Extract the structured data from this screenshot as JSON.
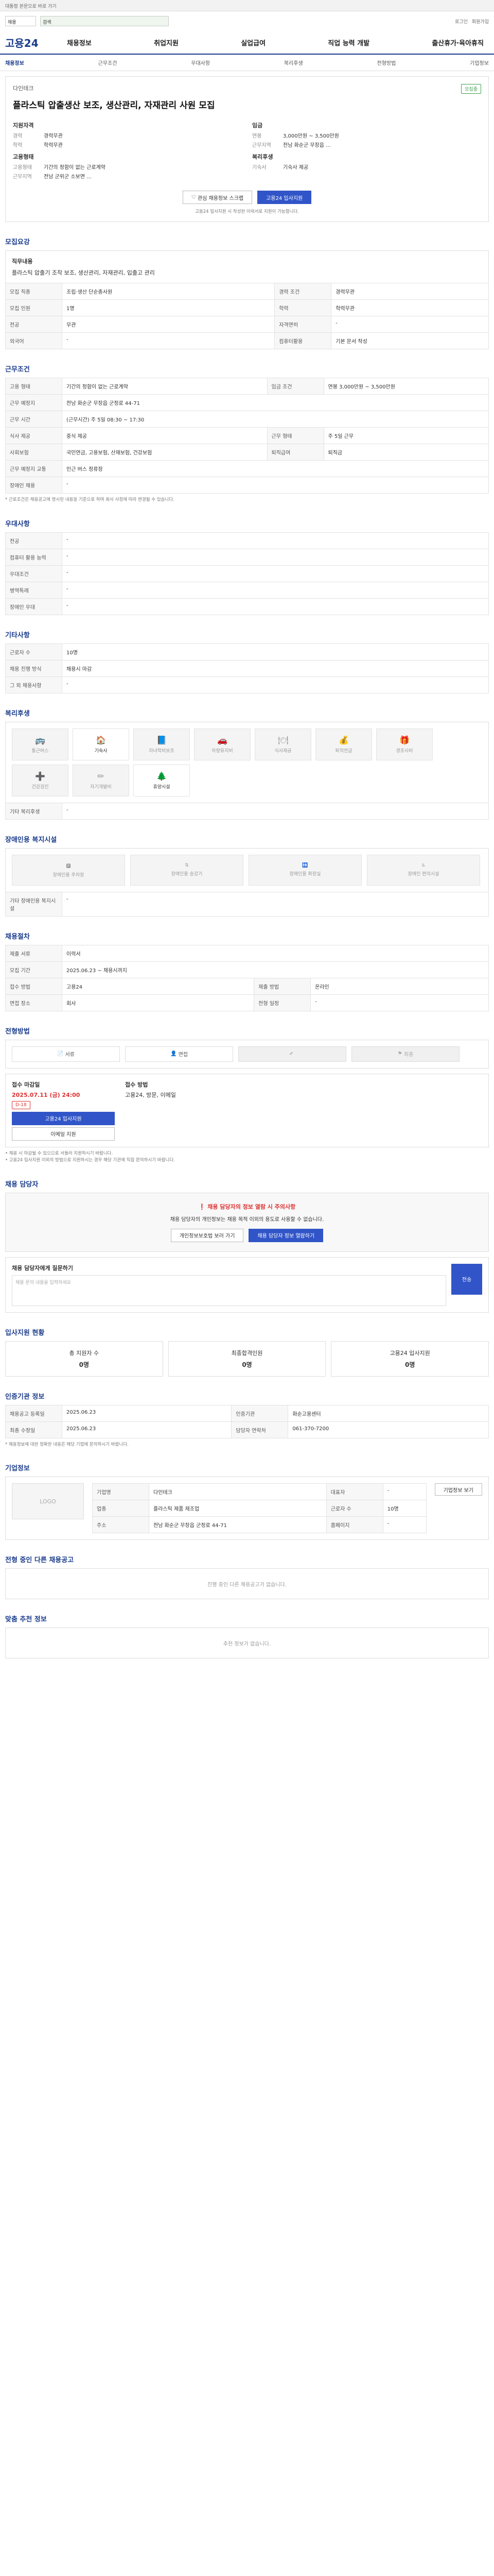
{
  "topbar": {
    "text": "대통령 본문으로 바로 가기"
  },
  "search": {
    "category": "채용",
    "placeholder": "검색"
  },
  "utility": {
    "login": "로그인",
    "join": "회원가입"
  },
  "brand": {
    "logo": "고용24"
  },
  "gnb": [
    "채용정보",
    "취업지원",
    "실업급여",
    "직업 능력 개발",
    "출산휴가·육아휴직"
  ],
  "lnb": [
    "채용정보",
    "근무조건",
    "우대사항",
    "복리후생",
    "전형방법",
    "기업정보"
  ],
  "job": {
    "company": "다인테크",
    "badge": "모집중",
    "title": "플라스틱 압출생산 보조, 생산관리, 자재관리 사원 모집",
    "left": {
      "head": "지원자격",
      "rows": [
        [
          "경력",
          "경력무관"
        ],
        [
          "학력",
          "학력무관"
        ]
      ],
      "head2": "고용형태",
      "rows2": [
        [
          "고용형태",
          "기간의 정함이 없는 근로계약"
        ],
        [
          "근무지역",
          "전남 군위군 소보면 ..."
        ]
      ]
    },
    "right": {
      "head": "임금",
      "rows": [
        [
          "연봉",
          "3,000만원 ~ 3,500만원"
        ],
        [
          "근무지역",
          "전남 화순군 무장읍 ..."
        ]
      ],
      "head2": "복리후생",
      "rows2": [
        [
          "기숙사",
          "기숙사 제공"
        ]
      ]
    },
    "btn_scrap": "관심 채용정보 스크랩",
    "btn_apply": "고용24 입사지원",
    "note": "고용24 입사지원 시 작성한 이력서로 지원이 가능합니다."
  },
  "sections": {
    "s1": "모집요강",
    "s2": "근무조건",
    "s3": "우대사항",
    "s4": "기타사항",
    "s5": "복리후생",
    "s6": "장애인용 복지시설",
    "s7": "채용절차",
    "s8": "전형방법",
    "s9": "채용 담당자",
    "s10": "입사지원 현황",
    "s11": "인증기관 정보",
    "s12": "기업정보",
    "s13": "전형 중인 다른 채용공고",
    "s14": "맞춤 추천 정보"
  },
  "recruit": {
    "duties_label": "직무내용",
    "duties": "플라스틱 압출기 조작 보조, 생산관리, 자재관리, 입출고 관리",
    "rows": [
      [
        "모집 직종",
        "조립·생산 단순종사원",
        "경력 조건",
        "경력무관"
      ],
      [
        "모집 인원",
        "1명",
        "학력",
        "학력무관"
      ],
      [
        "전공",
        "무관",
        "자격면허",
        "-"
      ],
      [
        "외국어",
        "-",
        "컴퓨터활용",
        "기본 문서 작성"
      ]
    ]
  },
  "cond": {
    "rows": [
      [
        "고용 형태",
        "기간의 정함이 없는 근로계약",
        "임금 조건",
        "연봉 3,000만원 ~ 3,500만원"
      ],
      [
        "근무 예정지",
        "전남 화순군 무장읍 군정로 44-71",
        "",
        ""
      ],
      [
        "근무 시간",
        "(근무시간) 주 5일 08:30 ~ 17:30",
        "",
        ""
      ],
      [
        "식사 제공",
        "중식 제공",
        "근무 형태",
        "주 5일 근무"
      ],
      [
        "사회보험",
        "국민연금, 고용보험, 산재보험, 건강보험",
        "퇴직급여",
        "퇴직금"
      ],
      [
        "근무 예정지 교통",
        "인근 버스 정류장",
        "",
        ""
      ],
      [
        "장애인 채용",
        "-",
        "",
        ""
      ]
    ],
    "foot": "* 근로조건은 채용공고에 명시된 내용을 기준으로 하며 회사 사정에 따라 변경될 수 있습니다."
  },
  "pref": {
    "rows": [
      [
        "전공",
        "-"
      ],
      [
        "컴퓨터 활용 능력",
        "-"
      ],
      [
        "우대조건",
        "-"
      ],
      [
        "병역특례",
        "-"
      ],
      [
        "장애인 우대",
        "-"
      ]
    ]
  },
  "etc": {
    "rows": [
      [
        "근로자 수",
        "10명"
      ],
      [
        "채용 진행 방식",
        "채용시 마감"
      ],
      [
        "그 외 채용사항",
        "-"
      ]
    ]
  },
  "welfare": {
    "items": [
      "통근버스",
      "기숙사",
      "자녀학비보조",
      "차량유지비",
      "식사제공",
      "퇴직연금",
      "경조사비",
      "건강검진",
      "자기개발비",
      "휴양시설"
    ],
    "on": [
      1,
      9
    ],
    "other_label": "기타 복리후생",
    "other": "-"
  },
  "facility": {
    "items": [
      "장애인용 주차장",
      "장애인용 승강기",
      "장애인용 화장실",
      "장애인 편의시설"
    ],
    "other_label": "기타 장애인용 복지시설",
    "other": "-"
  },
  "process": {
    "rows": [
      [
        "제출 서류",
        "이력서",
        "",
        ""
      ],
      [
        "모집 기간",
        "2025.06.23 ~ 채용시까지",
        "",
        ""
      ],
      [
        "접수 방법",
        "고용24",
        "제출 방법",
        "온라인"
      ],
      [
        "면접 장소",
        "회사",
        "전형 일정",
        "-"
      ]
    ]
  },
  "method": {
    "steps": [
      "서류",
      "면접",
      "",
      "최종"
    ],
    "deadline_label": "접수 마감일",
    "deadline": "2025.07.11 (금) 24:00",
    "dday": "D-18",
    "method_label": "접수 방법",
    "method": "고용24, 방문, 이메일",
    "btn_apply": "고용24 입사지원",
    "btn_email": "이메일 지원",
    "foot1": "• 채용 시 마감될 수 있으므로 서둘러 지원하시기 바랍니다.",
    "foot2": "• 고용24 입사지원 이외의 방법으로 지원하시는 경우 해당 기관에 직접 문의하시기 바랍니다."
  },
  "contact": {
    "warn": "채용 담당자의 정보 열람 시 주의사항",
    "msg": "채용 담당자의 개인정보는 채용 목적 이외의 용도로 사용할 수 없습니다.",
    "btn_view": "개인정보보호법 보러 가기",
    "btn_info": "채용 담당자 정보 열람하기",
    "q_label": "채용 담당자에게 질문하기",
    "q_placeholder": "채용 문의 내용을 입력하세요",
    "q_btn": "전송"
  },
  "status": [
    {
      "label": "총 지원자 수",
      "n": "0명"
    },
    {
      "label": "최종합격인원",
      "n": "0명"
    },
    {
      "label": "고용24 입사지원",
      "n": "0명"
    }
  ],
  "cert": {
    "rows": [
      [
        "채용공고 등록일",
        "2025.06.23",
        "인증기관",
        "화순고용센터"
      ],
      [
        "최종 수정일",
        "2025.06.23",
        "담당자 연락처",
        "061-370-7200"
      ]
    ],
    "foot": "* 채용정보에 대한 정확한 내용은 해당 기업에 문의하시기 바랍니다."
  },
  "company": {
    "logo": "LOGO",
    "rows": [
      [
        "기업명",
        "다인테크",
        "대표자",
        "-"
      ],
      [
        "업종",
        "플라스틱 제품 제조업",
        "근로자 수",
        "10명"
      ],
      [
        "주소",
        "전남 화순군 무장읍 군정로 44-71",
        "홈페이지",
        "-"
      ]
    ],
    "btn": "기업정보 보기"
  },
  "other": {
    "empty": "진행 중인 다른 채용공고가 없습니다."
  },
  "rec": {
    "empty": "추천 정보가 없습니다."
  }
}
